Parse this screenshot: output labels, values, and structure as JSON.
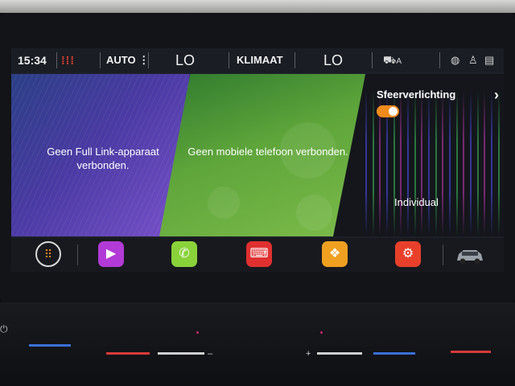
{
  "status_bar": {
    "time": "15:34",
    "seat_heat_icon": "heated-seat-icon",
    "auto_label": "AUTO",
    "auto_menu_icon": "⋮",
    "temp_left": "LO",
    "climate_label": "KLIMAAT",
    "temp_right": "LO",
    "car_auto_label": "A",
    "icons": [
      "car-air-icon",
      "globe-icon",
      "user-icon",
      "notes-icon"
    ]
  },
  "tiles": {
    "full_link": {
      "message": "Geen Full Link-apparaat verbonden."
    },
    "phone": {
      "message": "Geen mobiele telefoon verbonden."
    },
    "ambient": {
      "title": "Sfeerverlichting",
      "toggle_on": true,
      "mode": "Individual",
      "chevron": "›"
    }
  },
  "dock": {
    "apps": [
      {
        "name": "apps-grid",
        "glyph": "⠿",
        "color": "#f08a1c"
      },
      {
        "name": "media",
        "glyph": "▶",
        "color": "#b23ad6"
      },
      {
        "name": "phone",
        "glyph": "✆",
        "color": "#8ad23a"
      },
      {
        "name": "keyboard",
        "glyph": "⌨",
        "color": "#e03030"
      },
      {
        "name": "connectivity",
        "glyph": "❖",
        "color": "#f0a020"
      },
      {
        "name": "settings",
        "glyph": "⚙",
        "color": "#e8402a"
      }
    ]
  },
  "console": {
    "minus": "–",
    "plus": "+",
    "power_glyph": "⏻"
  }
}
